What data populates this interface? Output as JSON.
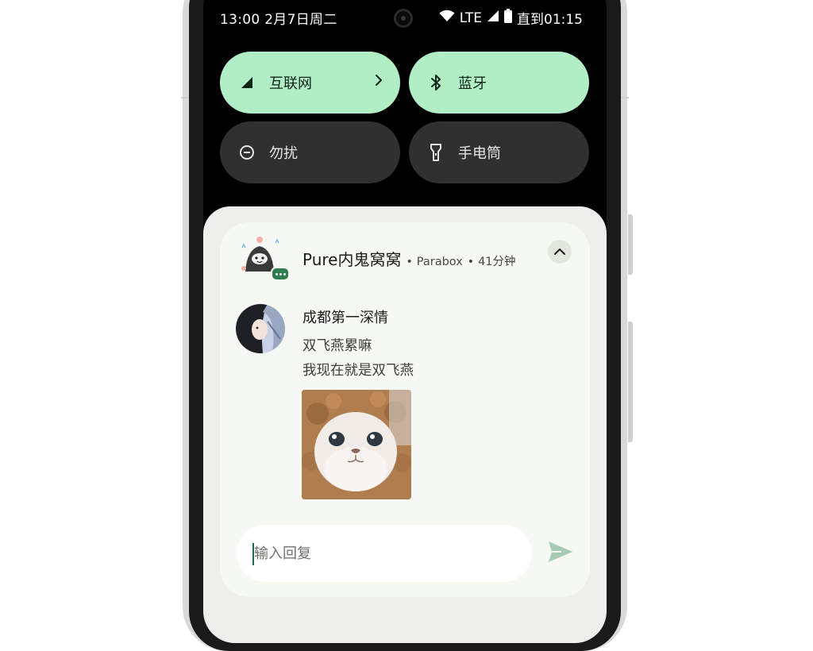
{
  "status_bar": {
    "time_date": "13:00 2月7日周二",
    "network": "LTE",
    "battery_text": "直到01:15"
  },
  "quick_tiles": [
    {
      "label": "互联网",
      "icon": "signal-icon",
      "active": true
    },
    {
      "label": "蓝牙",
      "icon": "bluetooth-icon",
      "active": true
    },
    {
      "label": "勿扰",
      "icon": "do-not-disturb-icon",
      "active": false
    },
    {
      "label": "手电筒",
      "icon": "flashlight-icon",
      "active": false
    }
  ],
  "notification": {
    "conversation_title": "Pure内鬼窝窝",
    "app_name": "Parabox",
    "time_ago": "41分钟",
    "sender": "成都第一深情",
    "messages": [
      "双飞燕累嘛",
      "我现在就是双飞燕"
    ],
    "image": "cat-photo",
    "reply_placeholder": "输入回复"
  },
  "colors": {
    "tile_active": "#b1eec6",
    "tile_inactive": "#303030",
    "accent": "#2e7d4f",
    "send_icon": "#a7cbb3"
  }
}
